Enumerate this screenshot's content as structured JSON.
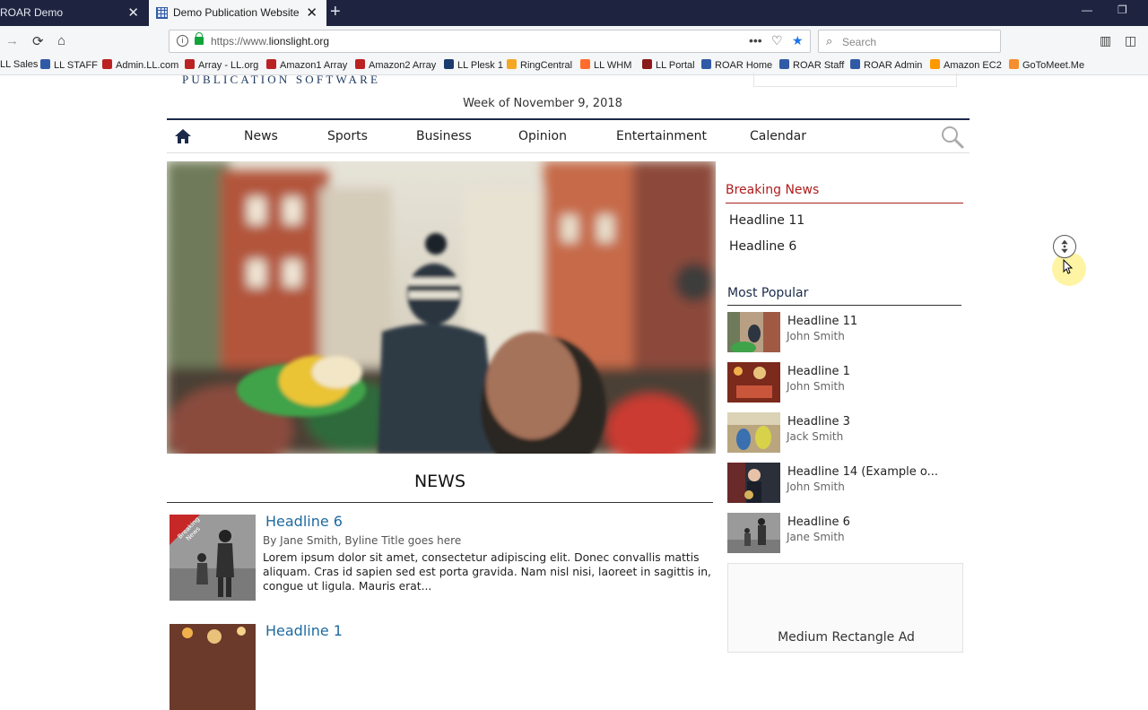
{
  "browser": {
    "tabs": [
      {
        "title": "ROAR Demo",
        "active": false
      },
      {
        "title": "Demo Publication Website",
        "active": true
      }
    ],
    "url_prefix": "https://www.",
    "url_domain": "lionslight.org",
    "search_placeholder": "Search",
    "bookmarks": [
      {
        "label": "LL Sales",
        "icon": "ll-icon",
        "color": "#b22"
      },
      {
        "label": "LL STAFF",
        "icon": "grid-icon",
        "color": "#315aa6"
      },
      {
        "label": "Admin.LL.com",
        "icon": "ll-icon",
        "color": "#b22"
      },
      {
        "label": "Array - LL.org",
        "icon": "ll-icon",
        "color": "#b22"
      },
      {
        "label": "Amazon1 Array",
        "icon": "ll-icon",
        "color": "#b22"
      },
      {
        "label": "Amazon2 Array",
        "icon": "ll-icon",
        "color": "#b22"
      },
      {
        "label": "LL Plesk 1",
        "icon": "plesk-icon",
        "color": "#1b3b6f"
      },
      {
        "label": "RingCentral",
        "icon": "ringcentral-icon",
        "color": "#f5a623"
      },
      {
        "label": "LL WHM",
        "icon": "cpanel-icon",
        "color": "#ff6c2c"
      },
      {
        "label": "LL Portal",
        "icon": "portal-icon",
        "color": "#8b1a1a"
      },
      {
        "label": "ROAR Home",
        "icon": "grid-icon",
        "color": "#315aa6"
      },
      {
        "label": "ROAR Staff",
        "icon": "grid-icon",
        "color": "#315aa6"
      },
      {
        "label": "ROAR Admin",
        "icon": "grid-icon",
        "color": "#315aa6"
      },
      {
        "label": "Amazon EC2",
        "icon": "ec2-icon",
        "color": "#f90"
      },
      {
        "label": "GoToMeet.Me",
        "icon": "gotomeeting-icon",
        "color": "#f68d2e"
      }
    ]
  },
  "site": {
    "brand_tagline": "PUBLICATION SOFTWARE",
    "week": "Week of November 9, 2018",
    "nav": [
      "News",
      "Sports",
      "Business",
      "Opinion",
      "Entertainment",
      "Calendar"
    ],
    "section_title": "NEWS",
    "articles": [
      {
        "headline": "Headline 6",
        "byline": "By Jane Smith, Byline Title goes here",
        "excerpt": "Lorem ipsum dolor sit amet, consectetur adipiscing elit. Donec convallis mattis aliquam. Cras id sapien sed est porta gravida. Nam nisl nisi, laoreet in sagittis in, congue ut ligula. Mauris erat...",
        "badge": "Breaking News"
      },
      {
        "headline": "Headline 1",
        "byline": "",
        "excerpt": ""
      }
    ],
    "breaking_news": {
      "title": "Breaking News",
      "items": [
        "Headline 11",
        "Headline 6"
      ]
    },
    "most_popular": {
      "title": "Most Popular",
      "items": [
        {
          "headline": "Headline 11",
          "author": "John Smith"
        },
        {
          "headline": "Headline 1",
          "author": "John Smith"
        },
        {
          "headline": "Headline 3",
          "author": "Jack Smith"
        },
        {
          "headline": "Headline 14 (Example o...",
          "author": "John Smith"
        },
        {
          "headline": "Headline 6",
          "author": "Jane Smith"
        }
      ]
    },
    "ad_label": "Medium Rectangle Ad",
    "colors": {
      "nav_border": "#1b2a4a",
      "headline_link": "#1e6aa0",
      "breaking_red": "#b01c1c"
    }
  }
}
